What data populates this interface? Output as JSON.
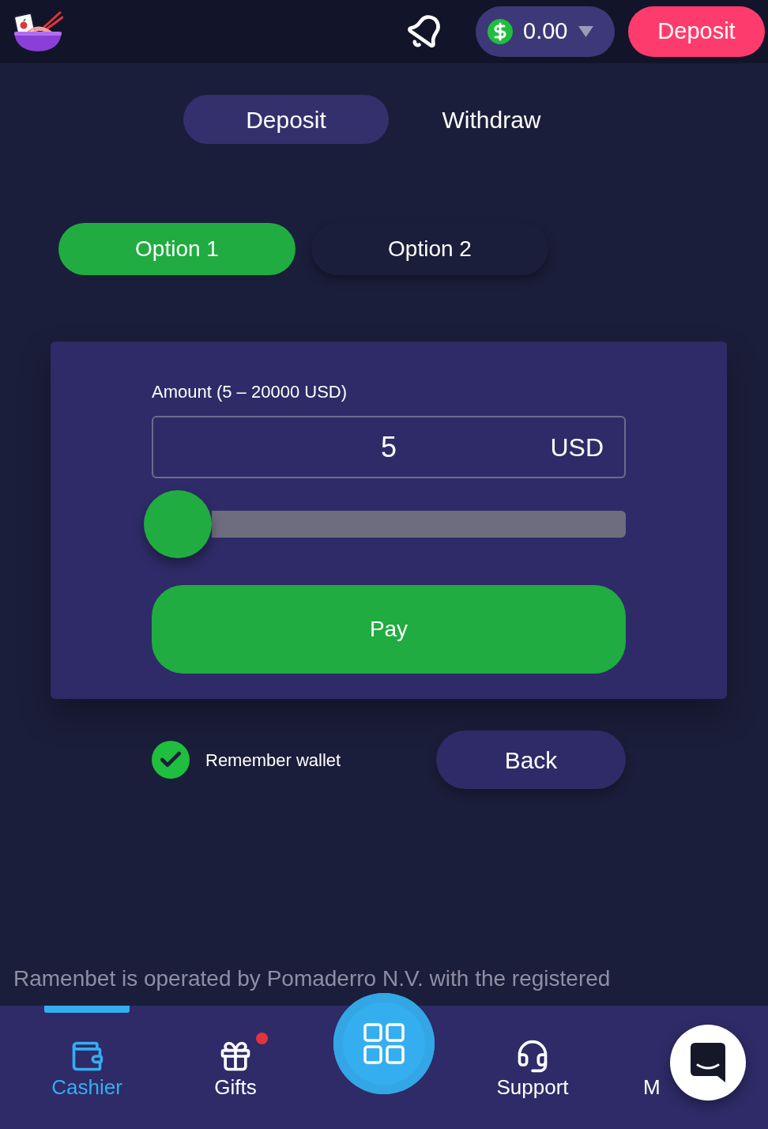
{
  "header": {
    "balance": "0.00",
    "deposit_button": "Deposit"
  },
  "tabs": [
    {
      "label": "Deposit",
      "selected": true
    },
    {
      "label": "Withdraw",
      "selected": false
    }
  ],
  "options": [
    {
      "label": "Option 1",
      "selected": true
    },
    {
      "label": "Option 2",
      "selected": false
    }
  ],
  "amount_form": {
    "label": "Amount (5 – 20000 USD)",
    "value": "5",
    "currency": "USD",
    "slider": {
      "level": 0
    },
    "pay_button": "Pay"
  },
  "remember_wallet": {
    "label": "Remember wallet",
    "checked": true
  },
  "back_button": "Back",
  "footer_text": "Ramenbet is operated by Pomaderro N.V. with the registered",
  "bottom_nav": [
    {
      "label": "Cashier",
      "selected": true,
      "notification": false
    },
    {
      "label": "Gifts",
      "selected": false,
      "notification": true
    },
    {
      "label": "Support",
      "selected": false,
      "notification": false
    },
    {
      "label": "M",
      "selected": false,
      "notification": false
    }
  ]
}
